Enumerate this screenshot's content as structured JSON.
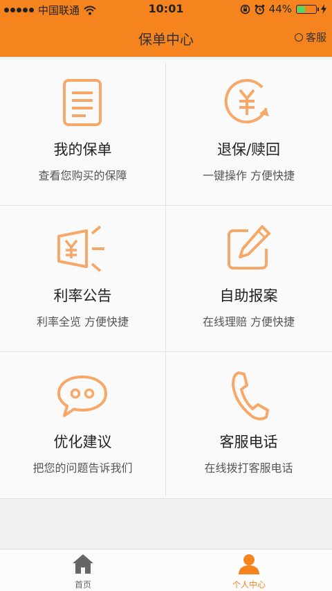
{
  "status_bar": {
    "carrier": "中国联通",
    "time": "10:01",
    "battery_percent": "44%",
    "battery_level": 0.44
  },
  "nav": {
    "title": "保单中心",
    "action_label": "客服"
  },
  "grid": [
    {
      "title": "我的保单",
      "subtitle": "查看您购买的保障",
      "icon": "document-icon"
    },
    {
      "title": "退保/赎回",
      "subtitle": "一键操作 方便快捷",
      "icon": "yuan-refund-icon"
    },
    {
      "title": "利率公告",
      "subtitle": "利率全览 方便快捷",
      "icon": "megaphone-icon"
    },
    {
      "title": "自助报案",
      "subtitle": "在线理赔 方便快捷",
      "icon": "edit-icon"
    },
    {
      "title": "优化建议",
      "subtitle": "把您的问题告诉我们",
      "icon": "chat-bubble-icon"
    },
    {
      "title": "客服电话",
      "subtitle": "在线拨打客服电话",
      "icon": "phone-icon"
    }
  ],
  "tabs": [
    {
      "label": "首页",
      "icon": "home-icon",
      "active": false
    },
    {
      "label": "个人中心",
      "icon": "user-icon",
      "active": true
    }
  ],
  "colors": {
    "brand": "#f5841f",
    "icon_stroke": "#f7a868",
    "tab_inactive": "#666666",
    "tab_active": "#f5841f"
  }
}
